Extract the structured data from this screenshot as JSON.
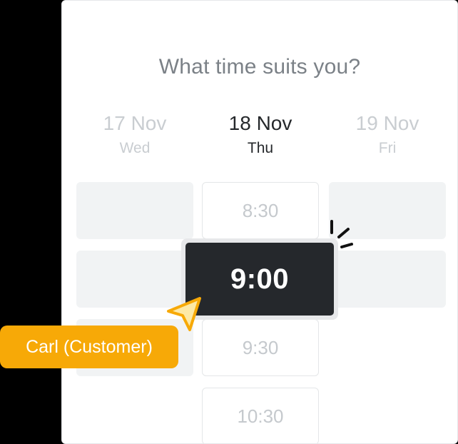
{
  "heading": "What time suits you?",
  "days": [
    {
      "date": "17 Nov",
      "dow": "Wed"
    },
    {
      "date": "18 Nov",
      "dow": "Thu"
    },
    {
      "date": "19 Nov",
      "dow": "Fri"
    }
  ],
  "slots": {
    "slot_830": "8:30",
    "slot_900": "9:00",
    "slot_930": "9:30",
    "slot_1030": "10:30"
  },
  "user_tag": "Carl (Customer)",
  "icons": {
    "cursor": "arrow-cursor-icon",
    "highlight": "sparkle-burst-icon"
  },
  "colors": {
    "accent": "#f7a907",
    "selected_bg": "#25282c",
    "muted_text": "#c9cdd1"
  }
}
